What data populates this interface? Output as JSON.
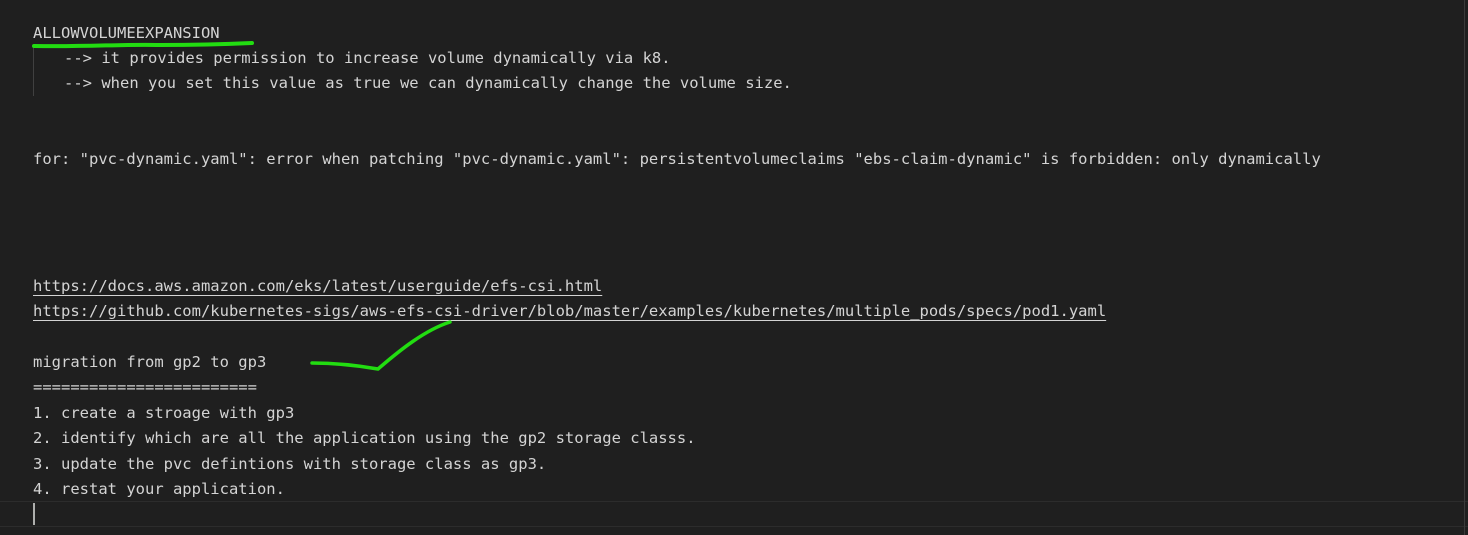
{
  "editor": {
    "lines": {
      "heading": "ALLOWVOLUMEEXPANSION",
      "note1": "--> it provides permission to increase volume dynamically via k8.",
      "note2": "--> when you set this value as true we can dynamically change the volume size.",
      "error": "for: \"pvc-dynamic.yaml\": error when patching \"pvc-dynamic.yaml\": persistentvolumeclaims \"ebs-claim-dynamic\" is forbidden: only dynamically",
      "link1": "https://docs.aws.amazon.com/eks/latest/userguide/efs-csi.html",
      "link2": "https://github.com/kubernetes-sigs/aws-efs-csi-driver/blob/master/examples/kubernetes/multiple_pods/specs/pod1.yaml",
      "migration_title": "migration from gp2 to gp3",
      "separator": "========================",
      "step1": "1. create a stroage with gp3",
      "step2": "2. identify which are all the application using the gp2 storage classs.",
      "step3": "3. update the pvc defintions with storage class as gp3.",
      "step4": "4. restat your application."
    }
  },
  "colors": {
    "background": "#1f1f1f",
    "text": "#d4d4d4",
    "annotation": "#22dd11"
  }
}
